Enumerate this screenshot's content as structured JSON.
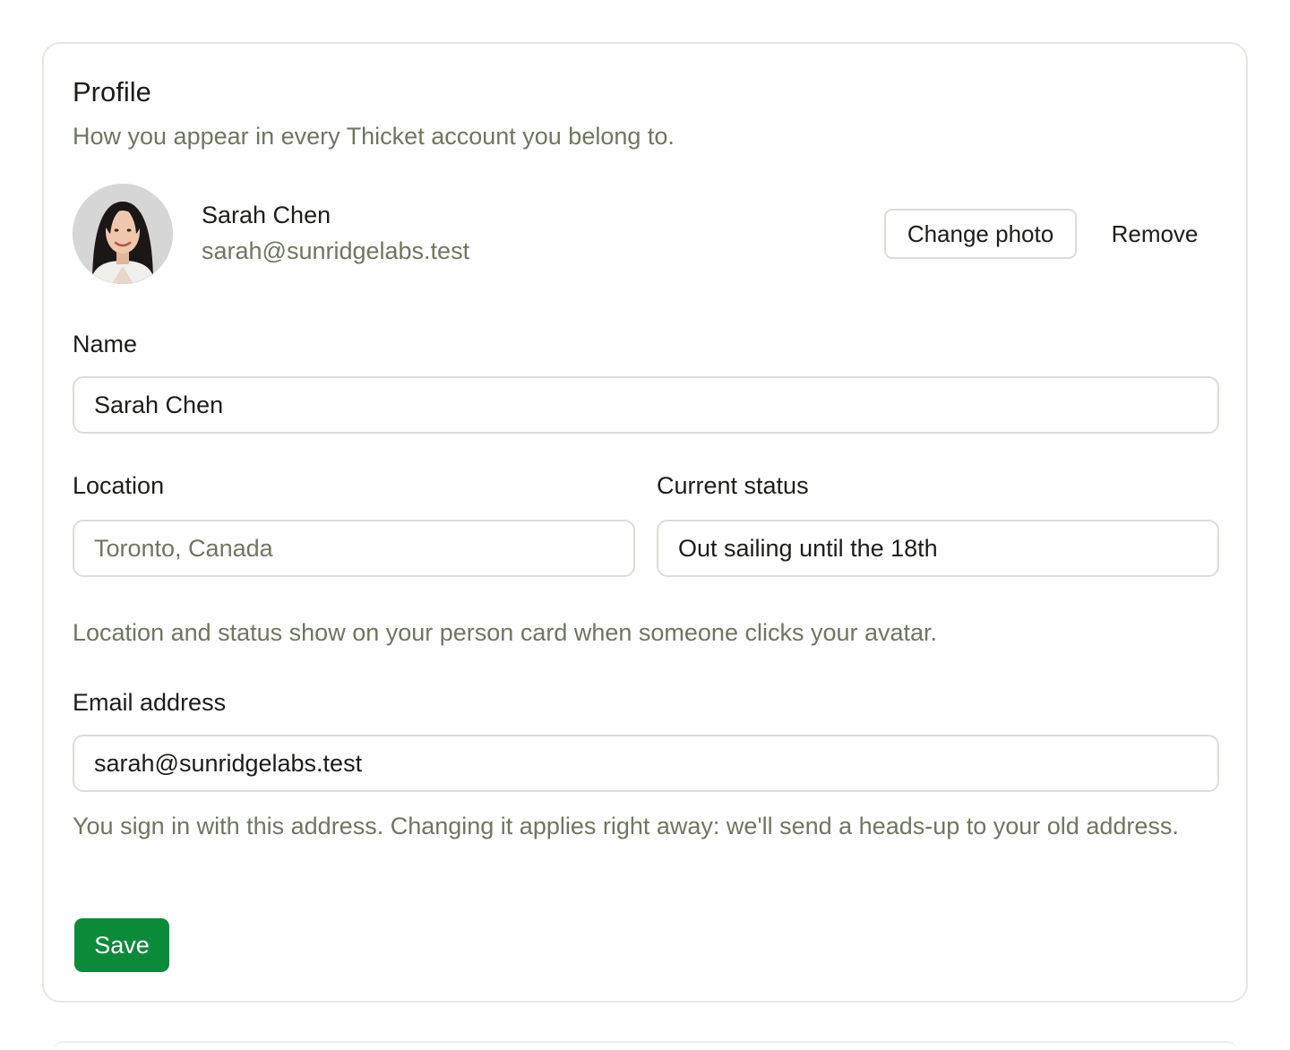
{
  "profile": {
    "title": "Profile",
    "subtitle": "How you appear in every Thicket account you belong to.",
    "identity": {
      "name": "Sarah Chen",
      "email": "sarah@sunridgelabs.test"
    },
    "change_photo_label": "Change photo",
    "remove_label": "Remove"
  },
  "form": {
    "name_label": "Name",
    "name_value": "Sarah Chen",
    "location_label": "Location",
    "location_placeholder": "Toronto, Canada",
    "location_value": "",
    "status_label": "Current status",
    "status_value": "Out sailing until the 18th",
    "location_help": "Location and status show on your person card when someone clicks your avatar.",
    "email_label": "Email address",
    "email_value": "sarah@sunridgelabs.test",
    "email_help": "You sign in with this address. Changing it applies right away: we'll send a heads-up to your old address.",
    "save_label": "Save"
  },
  "colors": {
    "accent": "#0b8a3a",
    "muted_text": "#6f7561",
    "border": "#dcdcd8"
  }
}
